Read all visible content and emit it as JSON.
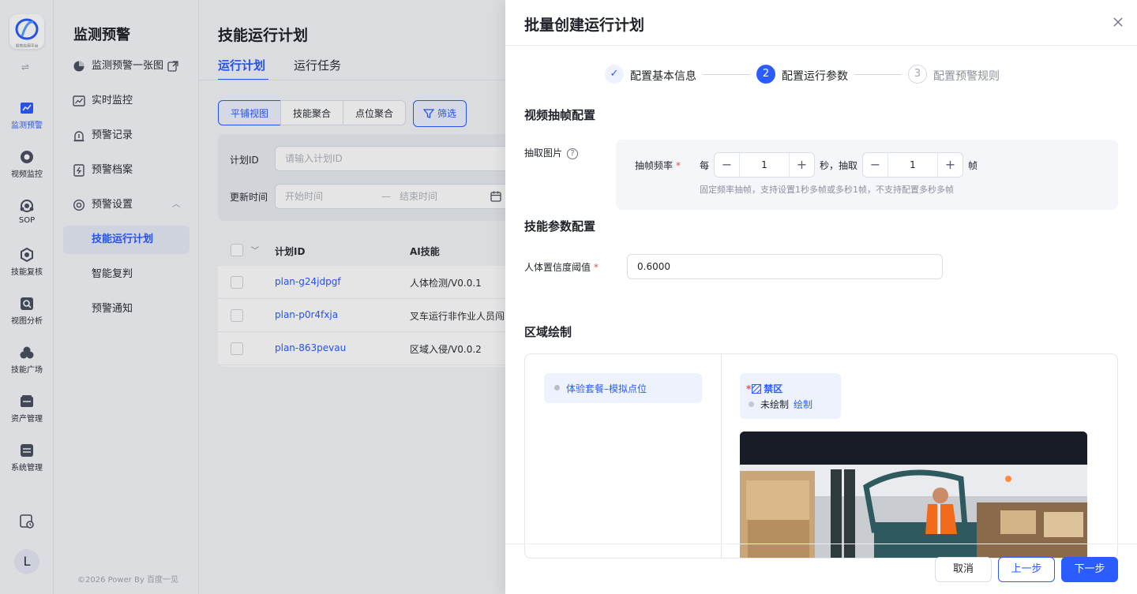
{
  "rail": {
    "logo_caption": "视觉应用平台",
    "items": [
      {
        "label": "监测预警",
        "icon": "chart-line-icon",
        "active": true
      },
      {
        "label": "视频监控",
        "icon": "camera-icon",
        "active": false
      },
      {
        "label": "SOP",
        "icon": "sop-icon",
        "active": false
      },
      {
        "label": "技能复核",
        "icon": "hexagon-icon",
        "active": false
      },
      {
        "label": "视图分析",
        "icon": "image-search-icon",
        "active": false
      },
      {
        "label": "技能广场",
        "icon": "circles-icon",
        "active": false
      },
      {
        "label": "资产管理",
        "icon": "asset-icon",
        "active": false
      },
      {
        "label": "系统管理",
        "icon": "settings-icon",
        "active": false
      }
    ],
    "avatar": "L"
  },
  "sidebar": {
    "title": "监测预警",
    "items": [
      {
        "label": "监测预警一张图",
        "icon": "pie-icon"
      },
      {
        "label": "实时监控",
        "icon": "monitor-icon"
      },
      {
        "label": "预警记录",
        "icon": "alarm-icon"
      },
      {
        "label": "预警档案",
        "icon": "file-icon"
      },
      {
        "label": "预警设置",
        "icon": "gear-icon"
      }
    ],
    "sub_items": [
      {
        "label": "技能运行计划",
        "active": true
      },
      {
        "label": "智能复判",
        "active": false
      },
      {
        "label": "预警通知",
        "active": false
      }
    ],
    "copyright": "©2026 Power By 百度一见"
  },
  "main": {
    "title": "技能运行计划",
    "tabs": [
      "运行计划",
      "运行任务"
    ],
    "view_modes": [
      "平铺视图",
      "技能聚合",
      "点位聚合"
    ],
    "filter_label": "筛选",
    "filters": {
      "plan_id_label": "计划ID",
      "plan_id_placeholder": "请输入计划ID",
      "update_time_label": "更新时间",
      "start_placeholder": "开始时间",
      "range_sep": "—",
      "end_placeholder": "结束时间"
    },
    "table": {
      "columns": [
        "计划ID",
        "AI技能"
      ],
      "rows": [
        {
          "id": "plan-g24jdpgf",
          "skill": "人体检测/V0.0.1"
        },
        {
          "id": "plan-p0r4fxja",
          "skill": "叉车运行非作业人员闯"
        },
        {
          "id": "plan-863pevau",
          "skill": "区域入侵/V0.0.2"
        }
      ]
    }
  },
  "drawer": {
    "title": "批量创建运行计划",
    "steps": [
      {
        "num": "✓",
        "label": "配置基本信息",
        "state": "done"
      },
      {
        "num": "2",
        "label": "配置运行参数",
        "state": "current"
      },
      {
        "num": "3",
        "label": "配置预警规则",
        "state": "todo"
      }
    ],
    "frame_section": {
      "title": "视频抽帧配置",
      "field_label": "抽取图片",
      "freq_label": "抽帧频率",
      "every": "每",
      "seconds_value": "1",
      "sec_extract": "秒，抽取",
      "frames_value": "1",
      "frame_unit": "帧",
      "hint": "固定频率抽帧，支持设置1秒多帧或多秒1帧，不支持配置多秒多帧"
    },
    "skill_section": {
      "title": "技能参数配置",
      "confidence_label": "人体置信度阈值",
      "confidence_value": "0.6000"
    },
    "area_section": {
      "title": "区域绘制",
      "point_name": "体验套餐–模拟点位",
      "zone_star": "*",
      "zone_name": "禁区",
      "zone_status": "未绘制",
      "zone_action": "绘制"
    },
    "footer": {
      "cancel": "取消",
      "prev": "上一步",
      "next": "下一步"
    }
  },
  "colors": {
    "primary": "#2b5cff",
    "required": "#e34d59"
  }
}
